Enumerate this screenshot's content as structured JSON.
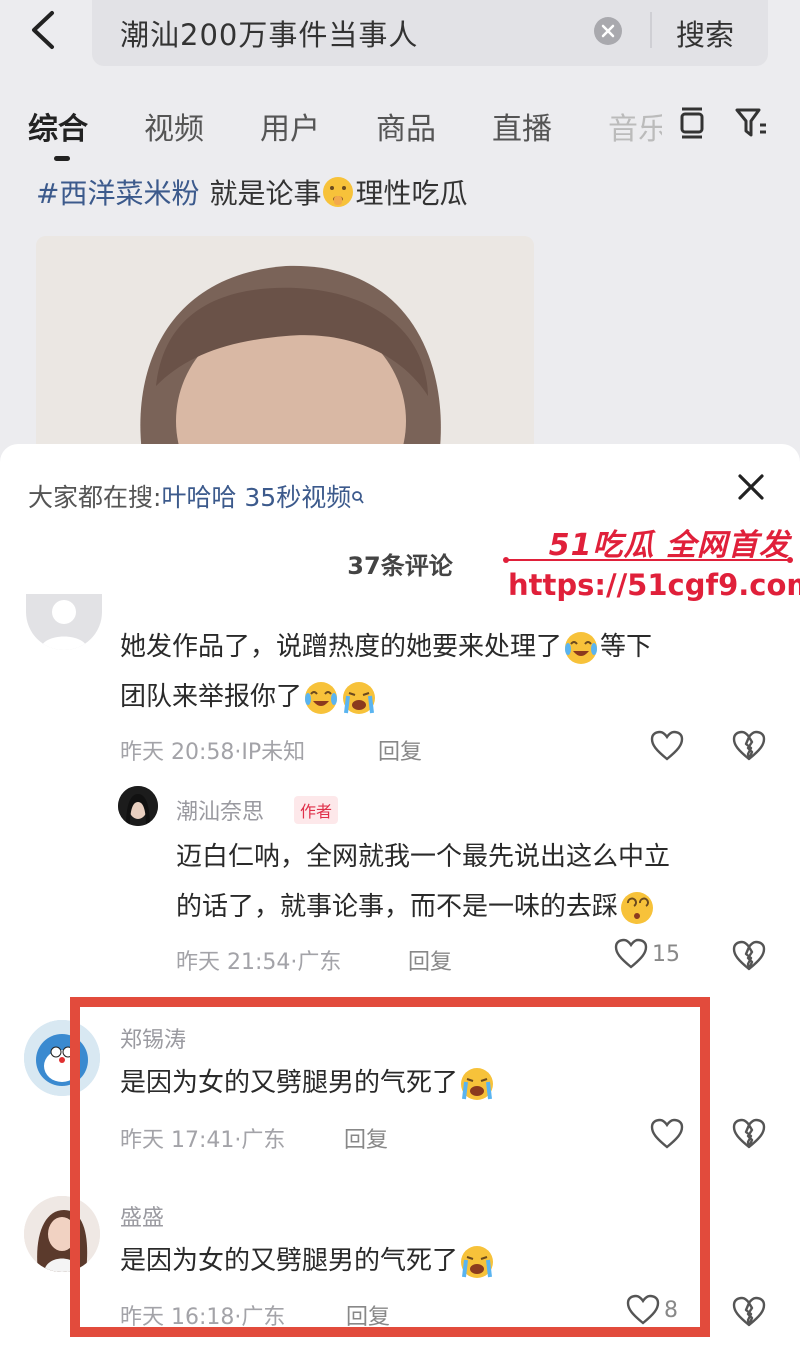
{
  "search": {
    "query": "潮汕200万事件当事人",
    "submit_label": "搜索"
  },
  "tabs": [
    {
      "label": "综合",
      "active": true
    },
    {
      "label": "视频"
    },
    {
      "label": "用户"
    },
    {
      "label": "商品"
    },
    {
      "label": "直播"
    },
    {
      "label": "音乐"
    }
  ],
  "post": {
    "hashtag": "#西洋菜米粉",
    "text_before": "就是论事",
    "text_after": "理性吃瓜"
  },
  "sheet": {
    "trending_prefix": "大家都在搜:",
    "trending_term": "叶哈哈 35秒视频",
    "comment_count": "37条评论"
  },
  "watermark": {
    "title": "51吃瓜 全网首发",
    "url": "https://51cgf9.com"
  },
  "comments": [
    {
      "text_line1": "她发作品了，说蹭热度的她要来处理了",
      "text_line1b": "等下",
      "text_line2": "团队来举报你了",
      "meta": "昨天 20:58·IP未知",
      "reply": "回复"
    },
    {
      "user": "潮汕奈思",
      "tag": "作者",
      "text_line1": "迈白仁呐，全网就我一个最先说出这么中立",
      "text_line2": "的话了，就事论事，而不是一味的去踩",
      "meta": "昨天 21:54·广东",
      "reply": "回复",
      "likes": "15"
    },
    {
      "user": "郑锡涛",
      "text": "是因为女的又劈腿男的气死了",
      "meta": "昨天 17:41·广东",
      "reply": "回复"
    },
    {
      "user": "盛盛",
      "text": "是因为女的又劈腿男的气死了",
      "meta": "昨天 16:18·广东",
      "reply": "回复",
      "likes": "8"
    }
  ],
  "colors": {
    "highlight": "#e24b3c",
    "watermark": "#e0203a",
    "link": "#3c5a8c"
  }
}
